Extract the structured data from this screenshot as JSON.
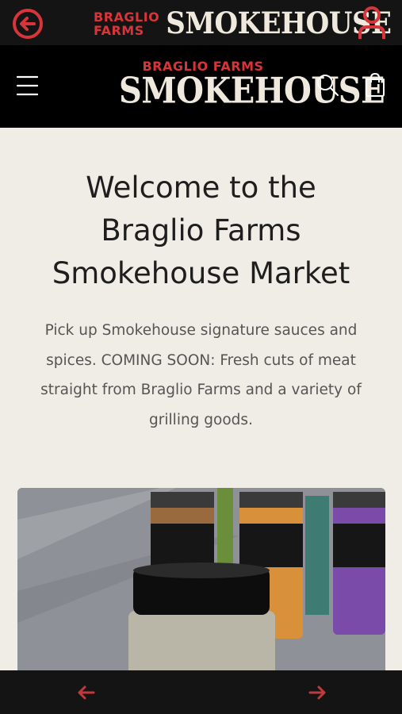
{
  "topbar": {
    "logo_small_line1": "BRAGLIO",
    "logo_small_line2": "FARMS",
    "logo_big": "SMOKEHOUSE"
  },
  "header": {
    "logo_small": "BRAGLIO FARMS",
    "logo_big": "SMOKEHOUSE"
  },
  "hero": {
    "title_line1": "Welcome to the",
    "title_line2": "Braglio Farms",
    "title_line3": "Smokehouse Market",
    "text": "Pick up Smokehouse signature sauces and spices. COMING SOON: Fresh cuts of meat straight from Braglio Farms and a variety of grilling goods."
  },
  "colors": {
    "accent": "#d8353a",
    "header_bg": "#000000",
    "page_bg": "#f0ede6"
  },
  "icons": {
    "back": "arrow-left-circle-icon",
    "account": "person-icon",
    "menu": "hamburger-icon",
    "search": "search-icon",
    "cart": "bag-icon",
    "prev": "arrow-left-icon",
    "next": "arrow-right-icon"
  }
}
